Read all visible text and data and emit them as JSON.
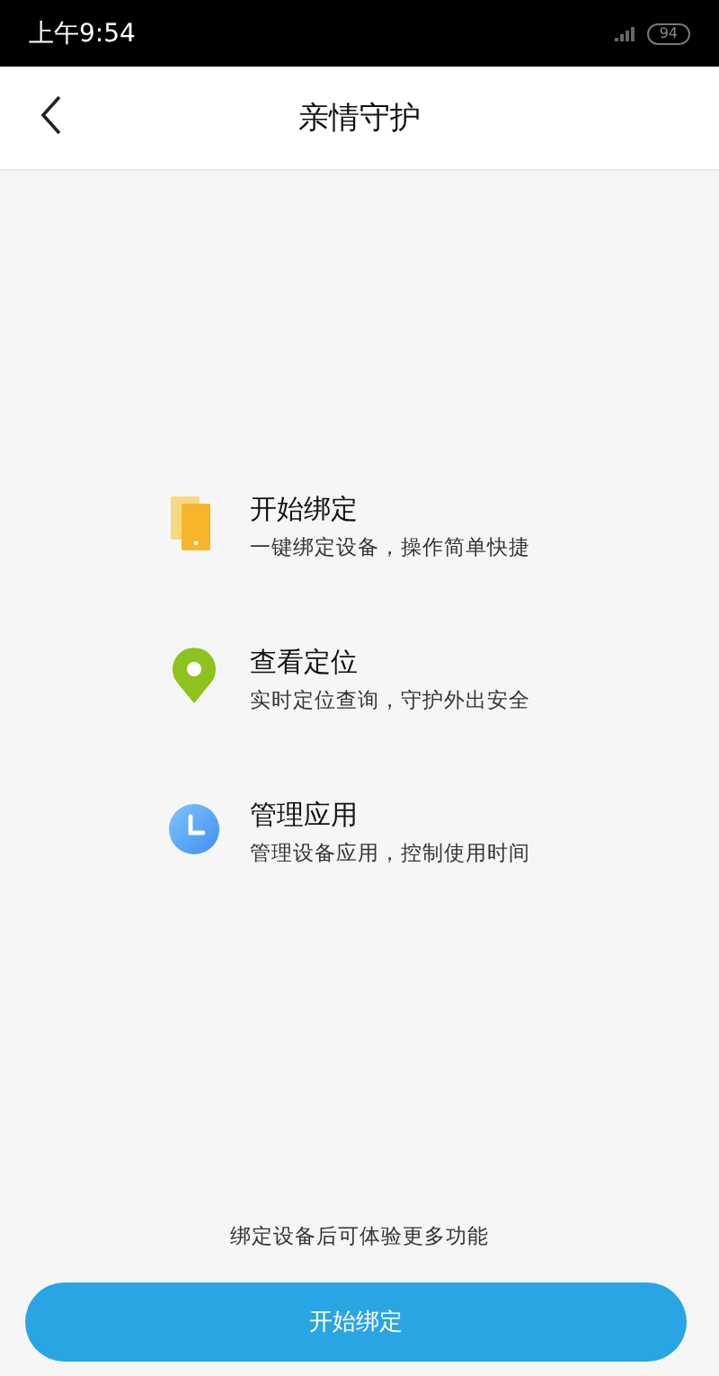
{
  "status_bar": {
    "time": "上午9:54",
    "battery": "94"
  },
  "header": {
    "title": "亲情守护"
  },
  "features": [
    {
      "kind": "phone",
      "title": "开始绑定",
      "subtitle": "一键绑定设备，操作简单快捷"
    },
    {
      "kind": "pin",
      "title": "查看定位",
      "subtitle": "实时定位查询，守护外出安全"
    },
    {
      "kind": "clock",
      "title": "管理应用",
      "subtitle": "管理设备应用，控制使用时间"
    }
  ],
  "hint": "绑定设备后可体验更多功能",
  "primary_button": "开始绑定"
}
